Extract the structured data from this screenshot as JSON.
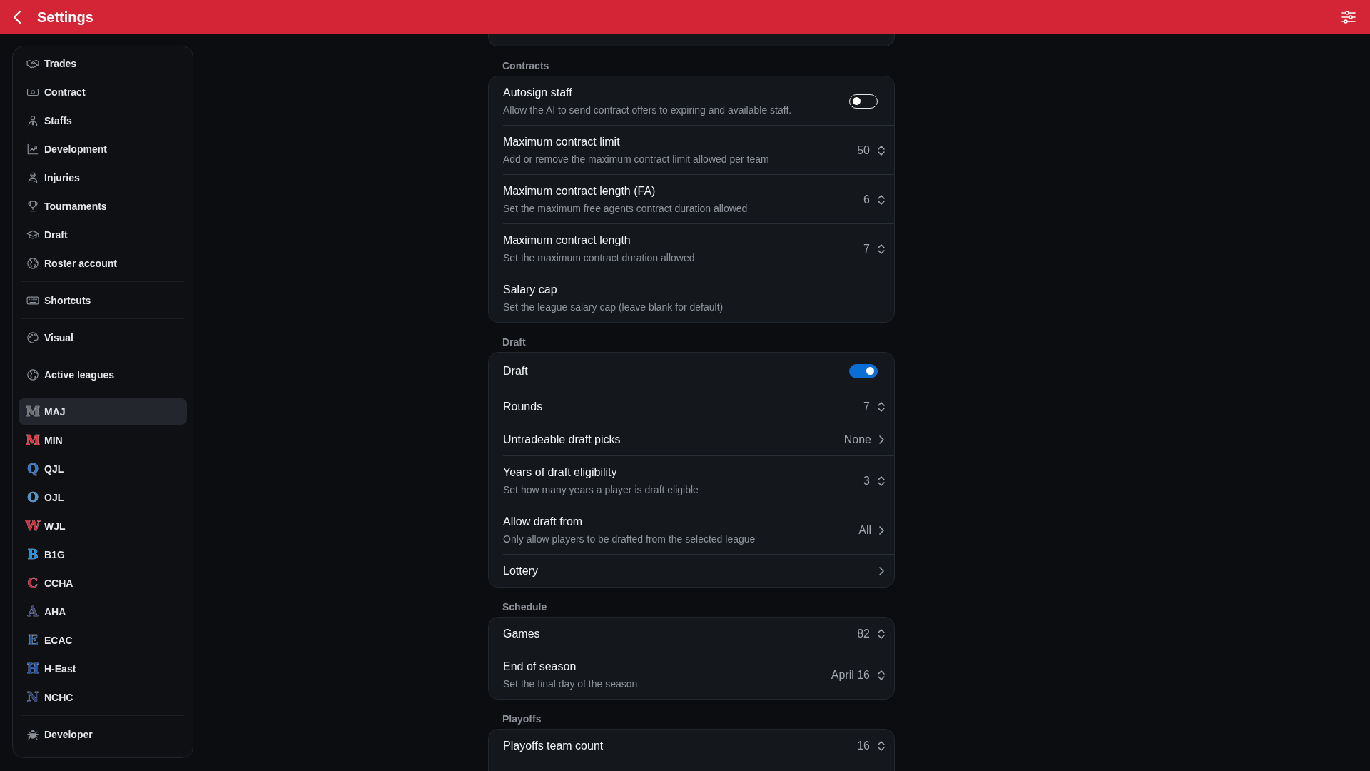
{
  "header": {
    "title": "Settings"
  },
  "sidebar": {
    "groups": [
      {
        "items": [
          {
            "kind": "page",
            "label": "Trades",
            "selected": false
          },
          {
            "kind": "page",
            "label": "Contract",
            "selected": false
          },
          {
            "kind": "page",
            "label": "Staffs",
            "selected": false
          },
          {
            "kind": "page",
            "label": "Development",
            "selected": false
          },
          {
            "kind": "page",
            "label": "Injuries",
            "selected": false
          },
          {
            "kind": "page",
            "label": "Tournaments",
            "selected": false
          },
          {
            "kind": "page",
            "label": "Draft",
            "selected": false
          },
          {
            "kind": "page",
            "label": "Roster account",
            "selected": false
          }
        ]
      },
      {
        "items": [
          {
            "kind": "page",
            "label": "Shortcuts",
            "selected": false
          }
        ]
      },
      {
        "items": [
          {
            "kind": "page",
            "label": "Visual",
            "selected": false
          }
        ]
      },
      {
        "items": [
          {
            "kind": "page",
            "label": "Active leagues",
            "selected": false
          }
        ]
      },
      {
        "items": [
          {
            "kind": "league",
            "logo": "M",
            "color": "#6e6e72",
            "label": "MAJ",
            "selected": true
          },
          {
            "kind": "league",
            "logo": "M",
            "color": "#e8323c",
            "label": "MIN",
            "selected": false
          },
          {
            "kind": "league",
            "logo": "Q",
            "color": "#2a7bd4",
            "label": "QJL",
            "selected": false
          },
          {
            "kind": "league",
            "logo": "O",
            "color": "#4a9ad6",
            "label": "OJL",
            "selected": false
          },
          {
            "kind": "league",
            "logo": "W",
            "color": "#d8283c",
            "label": "WJL",
            "selected": false
          },
          {
            "kind": "league",
            "logo": "B",
            "color": "#1f93e6",
            "label": "B1G",
            "selected": false
          },
          {
            "kind": "league",
            "logo": "C",
            "color": "#d21f3f",
            "label": "CCHA",
            "selected": false
          },
          {
            "kind": "league",
            "logo": "A",
            "color": "#3b4270",
            "label": "AHA",
            "selected": false
          },
          {
            "kind": "league",
            "logo": "E",
            "color": "#1f5290",
            "label": "ECAC",
            "selected": false
          },
          {
            "kind": "league",
            "logo": "H",
            "color": "#1b55b0",
            "label": "H-East",
            "selected": false
          },
          {
            "kind": "league",
            "logo": "N",
            "color": "#2a3c78",
            "label": "NCHC",
            "selected": false
          }
        ]
      },
      {
        "items": [
          {
            "kind": "page",
            "label": "Developer",
            "selected": false
          }
        ]
      }
    ]
  },
  "sections": [
    {
      "heading": "Contracts",
      "rows": [
        {
          "kind": "toggle",
          "title": "Autosign staff",
          "description": "Allow the AI to send contract offers to expiring and available staff.",
          "on": false
        },
        {
          "kind": "stepper",
          "title": "Maximum contract limit",
          "description": "Add or remove the maximum contract limit allowed per team",
          "value": "50"
        },
        {
          "kind": "stepper",
          "title": "Maximum contract length (FA)",
          "description": "Set the maximum free agents contract duration allowed",
          "value": "6"
        },
        {
          "kind": "stepper",
          "title": "Maximum contract length",
          "description": "Set the maximum contract duration allowed",
          "value": "7"
        },
        {
          "kind": "plain",
          "title": "Salary cap",
          "description": "Set the league salary cap (leave blank for default)"
        }
      ]
    },
    {
      "heading": "Draft",
      "rows": [
        {
          "kind": "toggle",
          "title": "Draft",
          "on": true
        },
        {
          "kind": "stepper",
          "title": "Rounds",
          "value": "7"
        },
        {
          "kind": "select",
          "title": "Untradeable draft picks",
          "value": "None"
        },
        {
          "kind": "stepper",
          "title": "Years of draft eligibility",
          "description": "Set how many years a player is draft eligible",
          "value": "3"
        },
        {
          "kind": "select",
          "title": "Allow draft from",
          "description": "Only allow players to be drafted from the selected league",
          "value": "All"
        },
        {
          "kind": "select",
          "title": "Lottery"
        }
      ]
    },
    {
      "heading": "Schedule",
      "rows": [
        {
          "kind": "stepper",
          "title": "Games",
          "value": "82"
        },
        {
          "kind": "stepper",
          "title": "End of season",
          "description": "Set the final day of the season",
          "value": "April 16"
        }
      ]
    },
    {
      "heading": "Playoffs",
      "rows": [
        {
          "kind": "stepper",
          "title": "Playoffs team count",
          "value": "16"
        }
      ]
    }
  ]
}
